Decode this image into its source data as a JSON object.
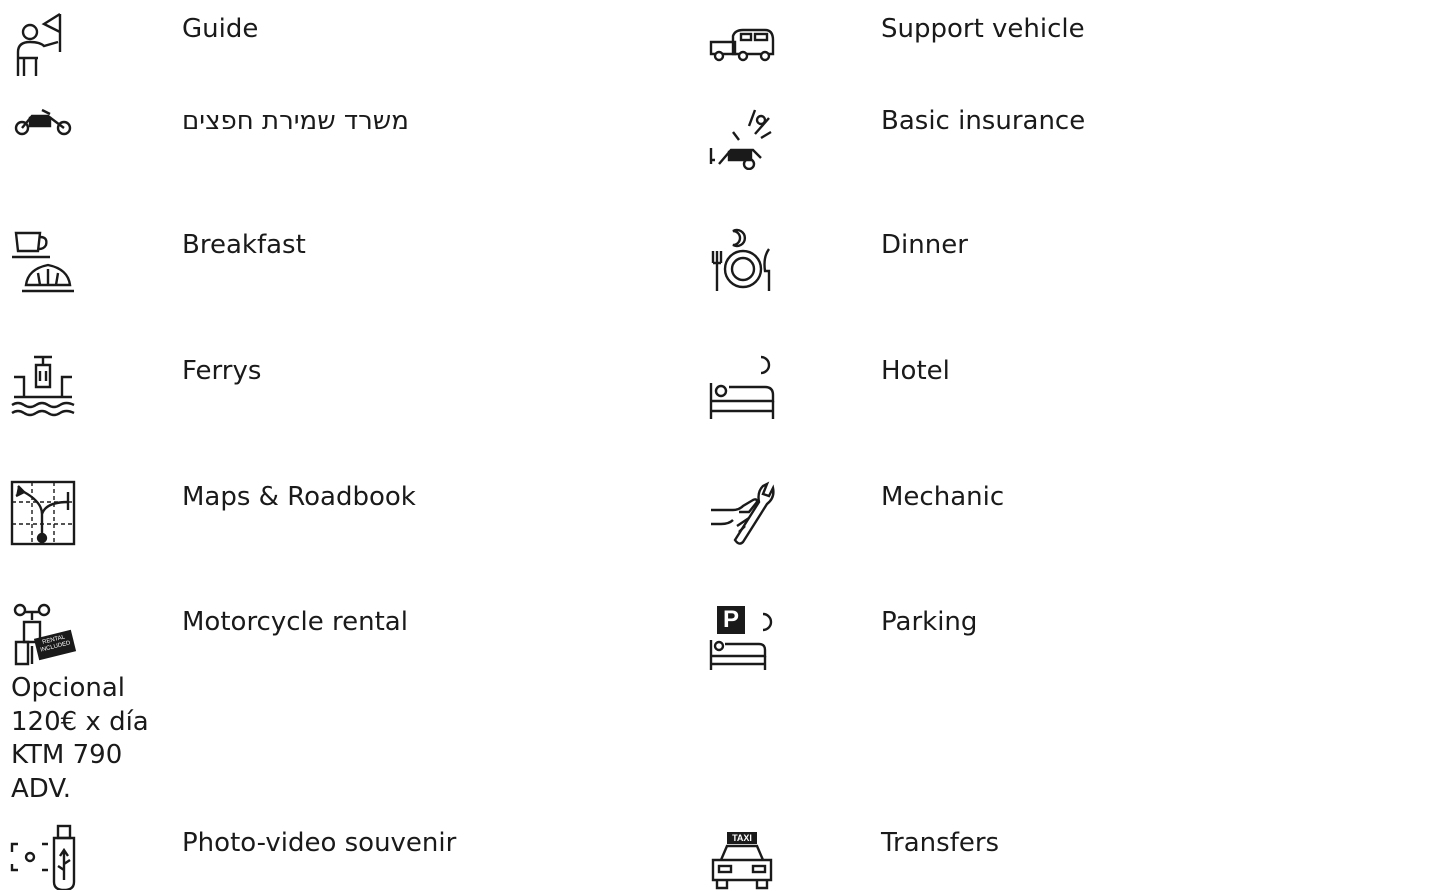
{
  "items": [
    {
      "label": "Guide",
      "icon": "guide-flag-icon"
    },
    {
      "label": "Support vehicle",
      "icon": "support-vehicle-icon"
    },
    {
      "label": "משרד שמירת חפצים",
      "icon": "motorcycle-storage-icon"
    },
    {
      "label": "Basic insurance",
      "icon": "motorcycle-crash-icon"
    },
    {
      "label": "Breakfast",
      "icon": "coffee-croissant-icon"
    },
    {
      "label": "Dinner",
      "icon": "plate-cutlery-moon-icon"
    },
    {
      "label": "Ferrys",
      "icon": "ferry-motorcycle-icon"
    },
    {
      "label": "Hotel",
      "icon": "bed-moon-icon"
    },
    {
      "label": "Maps & Roadbook",
      "icon": "roadbook-map-icon"
    },
    {
      "label": "Mechanic",
      "icon": "wrench-hand-icon"
    },
    {
      "label": "Motorcycle rental",
      "icon": "motorcycle-rental-icon",
      "note": "Opcional 120€ x día KTM 790 ADV."
    },
    {
      "label": "Parking",
      "icon": "parking-bed-moon-icon"
    },
    {
      "label": "Photo-video souvenir",
      "icon": "usb-camera-icon"
    },
    {
      "label": "Transfers",
      "icon": "taxi-icon"
    }
  ],
  "icon_text": {
    "rental_badge": "RENTAL INCLUDED",
    "taxi_sign": "TAXI",
    "parking_sign": "P"
  },
  "colors": {
    "text": "#1a1a1a",
    "icon": "#1a1a1a",
    "background": "#ffffff"
  }
}
